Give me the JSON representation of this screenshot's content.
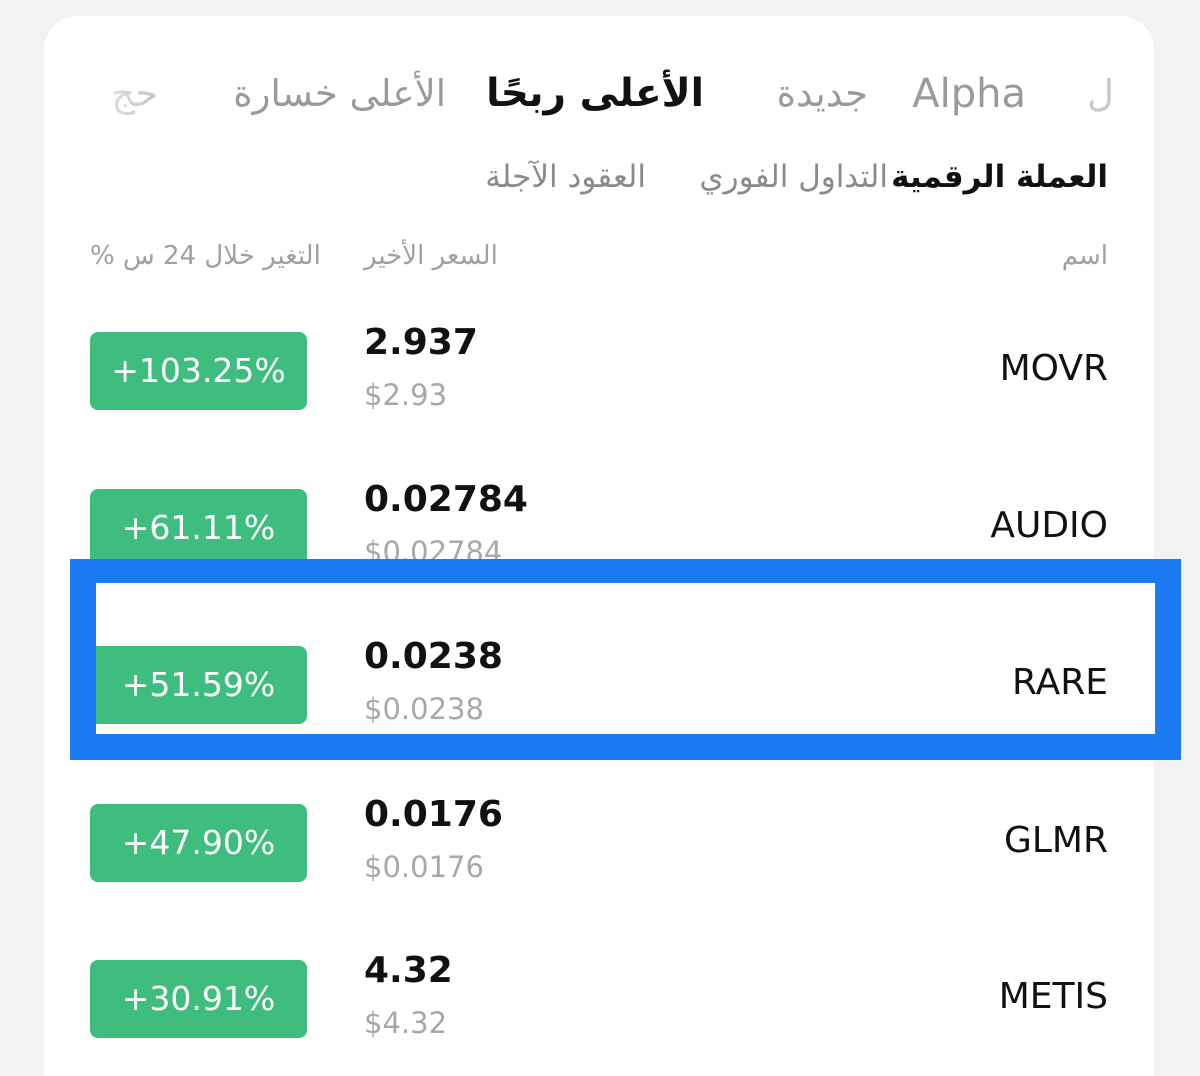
{
  "tabs": [
    {
      "label": "ل",
      "state": "partial"
    },
    {
      "label": "Alpha",
      "state": "normal"
    },
    {
      "label": "جديدة",
      "state": "normal"
    },
    {
      "label": "الأعلى ربحًا",
      "state": "active"
    },
    {
      "label": "الأعلى خسارة",
      "state": "normal"
    },
    {
      "label": "حج",
      "state": "partial"
    }
  ],
  "subtabs": [
    {
      "label": "العملة الرقمية",
      "state": "active"
    },
    {
      "label": "التداول الفوري",
      "state": "normal"
    },
    {
      "label": "العقود الآجلة",
      "state": "normal"
    }
  ],
  "columns": {
    "name": "اسم",
    "last_price": "السعر الأخير",
    "change_24h": "% التغير خلال 24 س"
  },
  "rows": [
    {
      "symbol": "MOVR",
      "price": "2.937",
      "usd": "$2.93",
      "change": "+103.25%"
    },
    {
      "symbol": "AUDIO",
      "price": "0.02784",
      "usd": "$0.02784",
      "change": "+61.11%"
    },
    {
      "symbol": "RARE",
      "price": "0.0238",
      "usd": "$0.0238",
      "change": "+51.59%",
      "highlighted": true
    },
    {
      "symbol": "GLMR",
      "price": "0.0176",
      "usd": "$0.0176",
      "change": "+47.90%"
    },
    {
      "symbol": "METIS",
      "price": "4.32",
      "usd": "$4.32",
      "change": "+30.91%"
    }
  ],
  "colors": {
    "positive": "#3ebd7f",
    "highlight": "#1a7cf0"
  }
}
